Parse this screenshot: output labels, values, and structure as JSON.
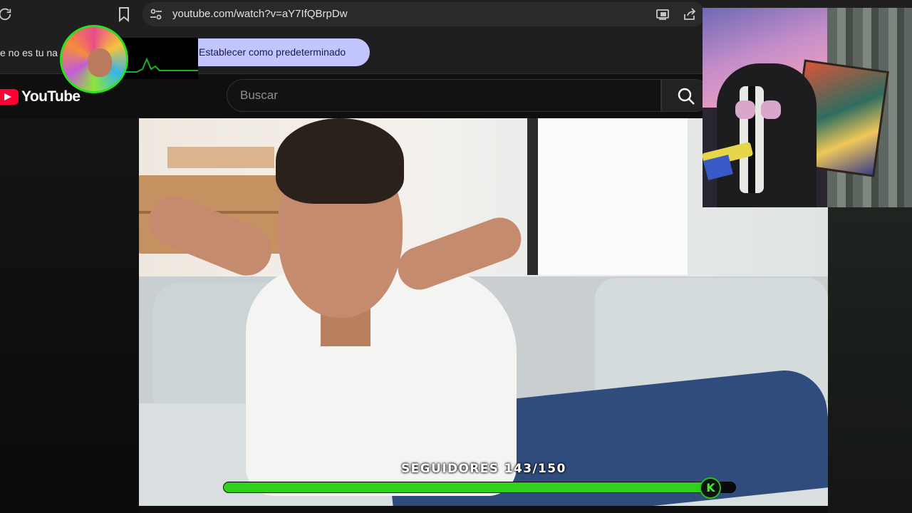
{
  "browser": {
    "url": "youtube.com/watch?v=aY7IfQBrpDw"
  },
  "infobar": {
    "message": "e no es tu na",
    "default_button_label": "Establecer como predeterminado"
  },
  "youtube": {
    "logo_text": "YouTube",
    "search_placeholder": "Buscar"
  },
  "stream_overlay": {
    "goal_label": "SEGUIDORES 143/150",
    "goal_current": 143,
    "goal_target": 150,
    "goal_knob_letter": "K",
    "accent_color": "#2fd11c"
  },
  "icons": {
    "reload": "reload-icon",
    "bookmark": "bookmark-icon",
    "site_info": "tune-icon",
    "cast": "cast-icon",
    "share": "share-icon",
    "search": "search-icon",
    "yt_play": "youtube-play-icon"
  }
}
